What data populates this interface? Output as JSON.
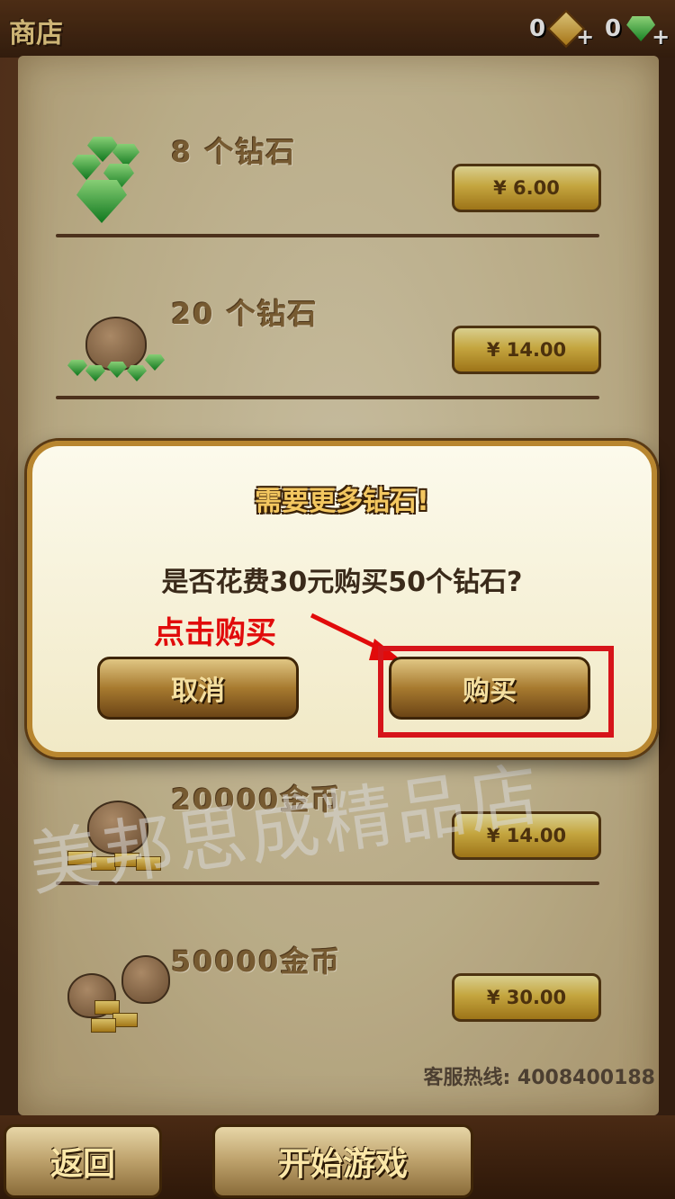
{
  "header": {
    "title": "商店",
    "coins_count": "0",
    "gems_count": "0",
    "plus": "+"
  },
  "items": [
    {
      "name": "8 个钻石",
      "price": "¥ 6.00"
    },
    {
      "name": "20 个钻石",
      "price": "¥ 14.00"
    },
    {
      "name": "20000金币",
      "price": "¥ 14.00"
    },
    {
      "name": "50000金币",
      "price": "¥ 30.00"
    }
  ],
  "dialog": {
    "title": "需要更多钻石!",
    "message": "是否花费30元购买50个钻石?",
    "annotation": "点击购买",
    "cancel_label": "取消",
    "buy_label": "购买"
  },
  "hotline": "客服热线: 4008400188",
  "footer": {
    "back_label": "返回",
    "start_label": "开始游戏"
  },
  "watermark": "美邦思成精品店"
}
